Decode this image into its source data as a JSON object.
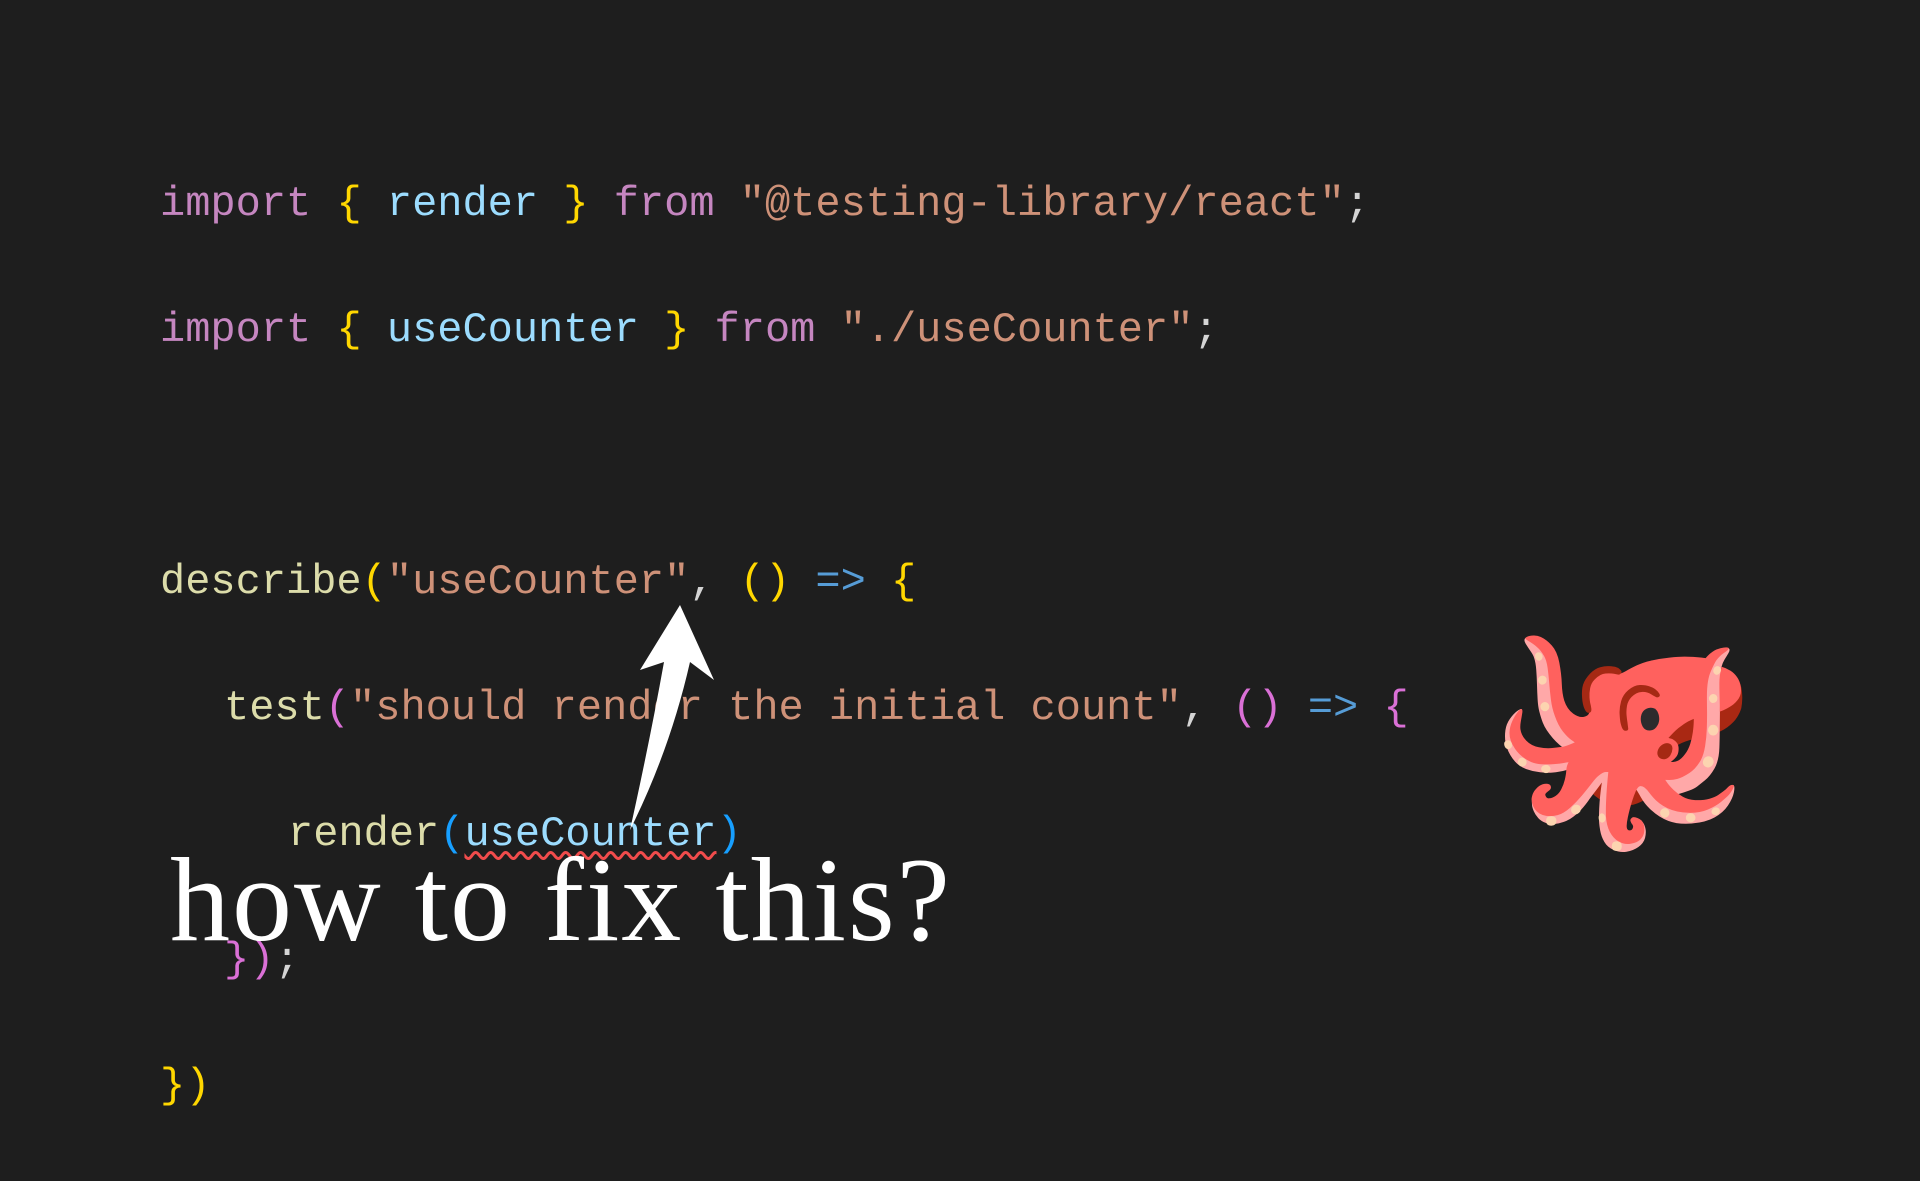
{
  "code": {
    "line1": {
      "import": "import",
      "braceO": " { ",
      "render": "render",
      "braceC": " } ",
      "from": "from ",
      "str": "\"@testing-library/react\"",
      "semi": ";"
    },
    "line2": {
      "import": "import",
      "braceO": " { ",
      "useCounter": "useCounter",
      "braceC": " } ",
      "from": "from ",
      "str": "\"./useCounter\"",
      "semi": ";"
    },
    "line4": {
      "describe": "describe",
      "parenO": "(",
      "str": "\"useCounter\"",
      "comma": ", ",
      "parenP": "()",
      "arrow": " => ",
      "braceO": "{"
    },
    "line5": {
      "test": "test",
      "parenO": "(",
      "str": "\"should render the initial count\"",
      "comma": ", ",
      "parenP": "()",
      "arrow": " => ",
      "braceO": "{"
    },
    "line6": {
      "render": "render",
      "parenO": "(",
      "useCounter": "useCounter",
      "parenC": ")"
    },
    "line7": {
      "braceC": "}",
      "parenC": ")",
      "semi": ";"
    },
    "line8": {
      "braceC": "}",
      "parenC": ")"
    }
  },
  "annotation": "how to fix this?",
  "octopus": "🐙",
  "error_token": "useCounter"
}
